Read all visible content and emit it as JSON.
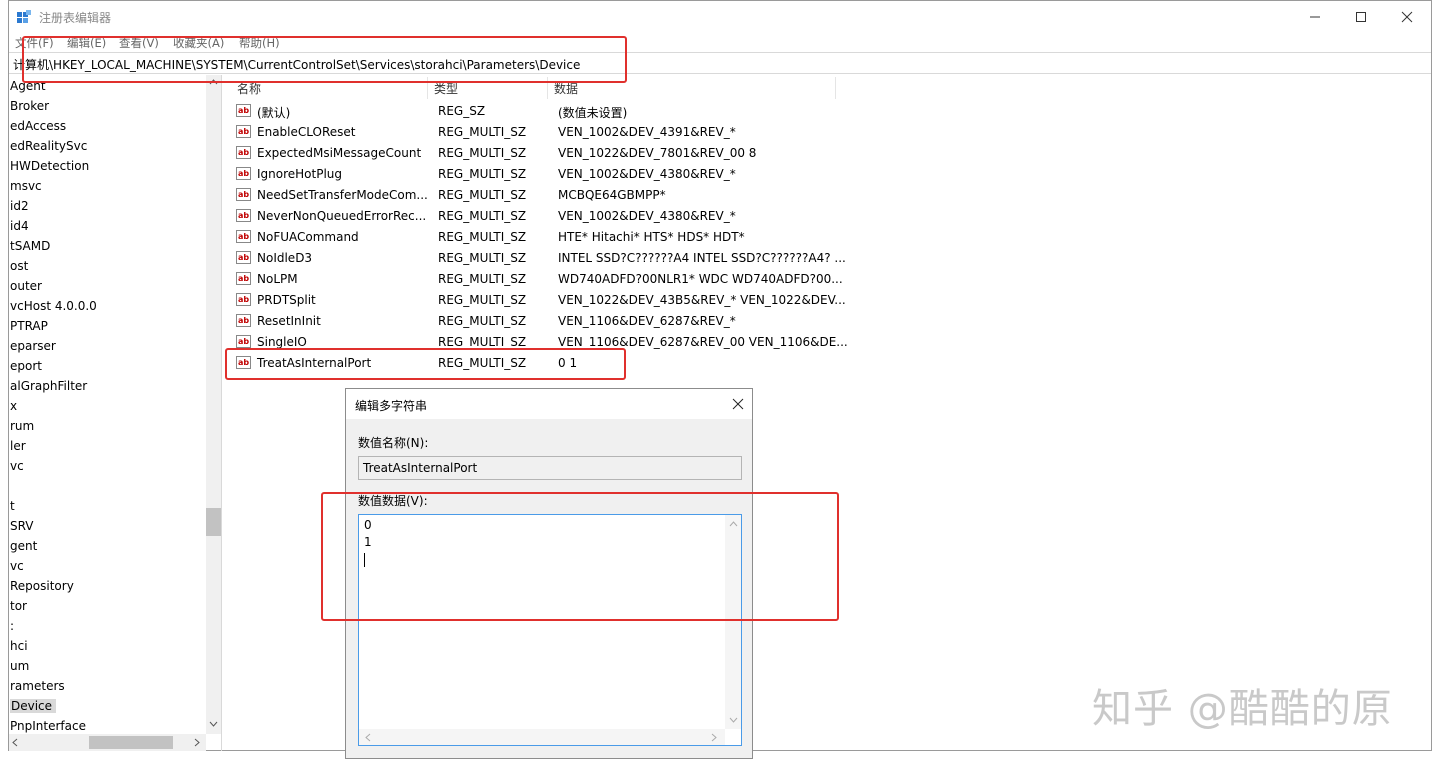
{
  "window": {
    "title": "注册表编辑器",
    "controls": [
      "minimize",
      "maximize",
      "close"
    ]
  },
  "menu": [
    "文件(F)",
    "编辑(E)",
    "查看(V)",
    "收藏夹(A)",
    "帮助(H)"
  ],
  "address": "计算机\\HKEY_LOCAL_MACHINE\\SYSTEM\\CurrentControlSet\\Services\\storahci\\Parameters\\Device",
  "tree": {
    "items": [
      "Agent",
      "Broker",
      "edAccess",
      "edRealitySvc",
      "HWDetection",
      "msvc",
      "id2",
      "id4",
      "tSAMD",
      "ost",
      "outer",
      "vcHost 4.0.0.0",
      "PTRAP",
      "eparser",
      "eport",
      "alGraphFilter",
      "x",
      "rum",
      "ler",
      "vc",
      "",
      "t",
      "SRV",
      "gent",
      "vc",
      "Repository",
      "tor",
      ":",
      "hci",
      "um",
      "rameters",
      "Device",
      "PnpInterface"
    ],
    "selected": "Device"
  },
  "list": {
    "headers": [
      "名称",
      "类型",
      "数据"
    ],
    "rows": [
      {
        "name": "(默认)",
        "type": "REG_SZ",
        "data": "(数值未设置)"
      },
      {
        "name": "EnableCLOReset",
        "type": "REG_MULTI_SZ",
        "data": "VEN_1002&DEV_4391&REV_*"
      },
      {
        "name": "ExpectedMsiMessageCount",
        "type": "REG_MULTI_SZ",
        "data": "VEN_1022&DEV_7801&REV_00 8"
      },
      {
        "name": "IgnoreHotPlug",
        "type": "REG_MULTI_SZ",
        "data": "VEN_1002&DEV_4380&REV_*"
      },
      {
        "name": "NeedSetTransferModeCom...",
        "type": "REG_MULTI_SZ",
        "data": "MCBQE64GBMPP*"
      },
      {
        "name": "NeverNonQueuedErrorRec...",
        "type": "REG_MULTI_SZ",
        "data": "VEN_1002&DEV_4380&REV_*"
      },
      {
        "name": "NoFUACommand",
        "type": "REG_MULTI_SZ",
        "data": "HTE* Hitachi* HTS* HDS* HDT*"
      },
      {
        "name": "NoIdleD3",
        "type": "REG_MULTI_SZ",
        "data": "INTEL SSD?C??????A4 INTEL SSD?C??????A4? ..."
      },
      {
        "name": "NoLPM",
        "type": "REG_MULTI_SZ",
        "data": "WD740ADFD?00NLR1* WDC WD740ADFD?00..."
      },
      {
        "name": "PRDTSplit",
        "type": "REG_MULTI_SZ",
        "data": "VEN_1022&DEV_43B5&REV_* VEN_1022&DEV..."
      },
      {
        "name": "ResetInInit",
        "type": "REG_MULTI_SZ",
        "data": "VEN_1106&DEV_6287&REV_*"
      },
      {
        "name": "SingleIO",
        "type": "REG_MULTI_SZ",
        "data": "VEN_1106&DEV_6287&REV_00 VEN_1106&DE..."
      },
      {
        "name": "TreatAsInternalPort",
        "type": "REG_MULTI_SZ",
        "data": "0 1"
      }
    ]
  },
  "dialog": {
    "title": "编辑多字符串",
    "name_label": "数值名称(N):",
    "name_value": "TreatAsInternalPort",
    "data_label": "数值数据(V):",
    "data_lines": [
      "0",
      "1"
    ]
  },
  "watermark": "知乎 @酷酷的原",
  "annotation_color": "#e0302d"
}
